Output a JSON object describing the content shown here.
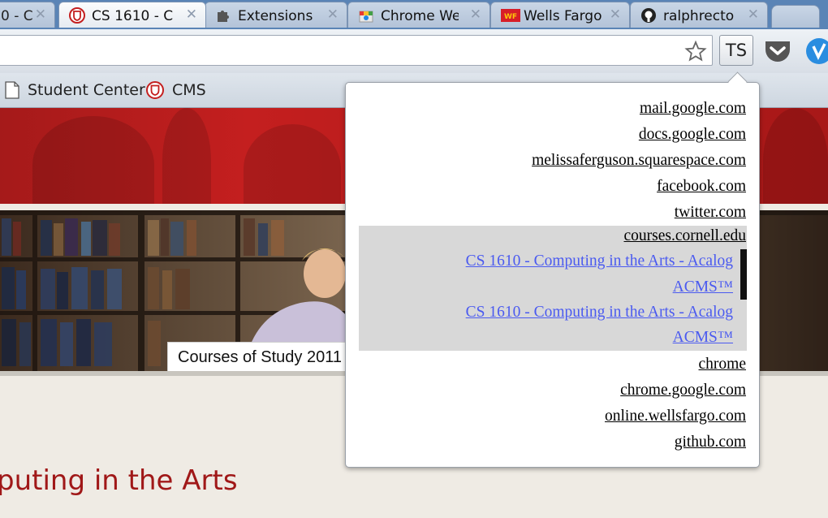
{
  "tabs": [
    {
      "title": "0 - C",
      "active": false,
      "favicon": "partial-icon"
    },
    {
      "title": "CS 1610 - C",
      "active": true,
      "favicon": "cornell-shield-icon"
    },
    {
      "title": "Extensions",
      "active": false,
      "favicon": "puzzle-icon"
    },
    {
      "title": "Chrome We",
      "active": false,
      "favicon": "chrome-web-store-icon"
    },
    {
      "title": "Wells Fargo",
      "active": false,
      "favicon": "wells-fargo-icon"
    },
    {
      "title": "ralphrecto",
      "active": false,
      "favicon": "github-icon"
    }
  ],
  "wells_fargo_favicon_text": "WF",
  "toolbar": {
    "extension_label": "TS"
  },
  "bookmarks": [
    {
      "label": "Student Center",
      "icon": "page-icon"
    },
    {
      "label": "CMS",
      "icon": "cornell-shield-icon"
    }
  ],
  "page": {
    "caption": "Courses of Study 2011",
    "heading": "puting in the Arts"
  },
  "popup": {
    "links": [
      "mail.google.com",
      "docs.google.com",
      "melissaferguson.squarespace.com",
      "facebook.com",
      "twitter.com",
      "courses.cornell.edu",
      "chrome",
      "chrome.google.com",
      "online.wellsfargo.com",
      "github.com"
    ],
    "expanded_group": {
      "domain": "courses.cornell.edu",
      "pages": [
        {
          "line1": "CS 1610 - Computing in the Arts - Acalog",
          "line2": "ACMS™"
        },
        {
          "line1": "CS 1610 - Computing in the Arts - Acalog",
          "line2": "ACMS™"
        }
      ]
    }
  },
  "colors": {
    "tabstrip": "#5a84b6",
    "banner_red": "#c41f1f",
    "heading_red": "#a01818",
    "sublink_blue": "#4a5af0",
    "group_bg": "#d8d8d8"
  }
}
